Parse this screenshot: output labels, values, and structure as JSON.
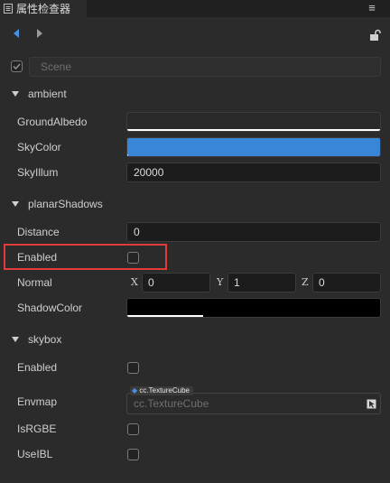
{
  "window": {
    "title": "属性检查器"
  },
  "scene": {
    "placeholder": "Scene"
  },
  "sections": {
    "ambient": "ambient",
    "planar_shadows": "planarShadows",
    "skybox": "skybox"
  },
  "ambient": {
    "ground_albedo_label": "GroundAlbedo",
    "sky_color_label": "SkyColor",
    "sky_color_hex": "#3a86d6",
    "sky_illum_label": "SkyIllum",
    "sky_illum_value": "20000"
  },
  "planar_shadows": {
    "distance_label": "Distance",
    "distance_value": "0",
    "enabled_label": "Enabled",
    "normal_label": "Normal",
    "normal_x_label": "X",
    "normal_x": "0",
    "normal_y_label": "Y",
    "normal_y": "1",
    "normal_z_label": "Z",
    "normal_z": "0",
    "shadow_color_label": "ShadowColor",
    "shadow_color_hex": "#000000"
  },
  "skybox": {
    "enabled_label": "Enabled",
    "envmap_label": "Envmap",
    "envmap_type_tag": "cc.TextureCube",
    "envmap_placeholder": "cc.TextureCube",
    "is_rgbe_label": "IsRGBE",
    "use_ibl_label": "UseIBL"
  },
  "colors": {
    "accent": "#4a90e2",
    "highlight": "#e23b3b"
  }
}
